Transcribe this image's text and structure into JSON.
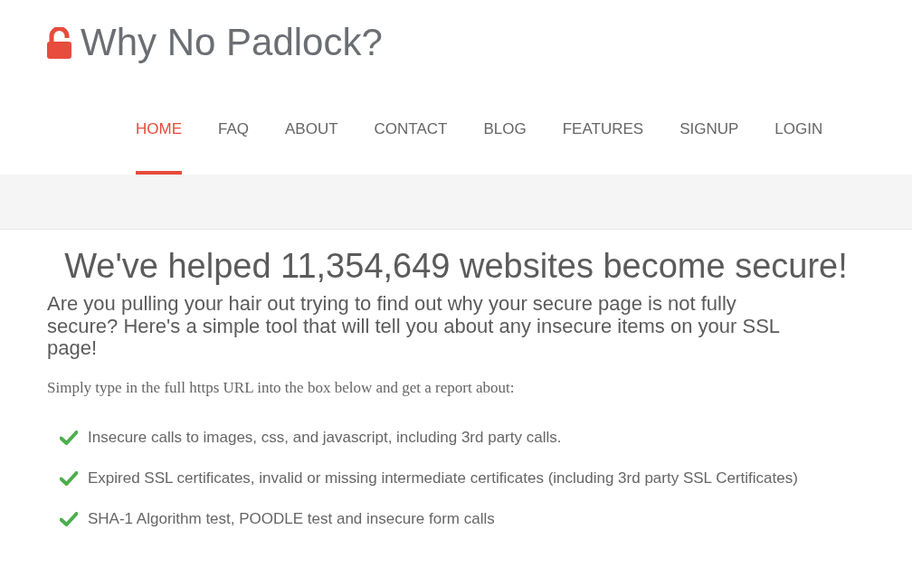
{
  "logo": {
    "title": "Why No Padlock?"
  },
  "nav": [
    {
      "label": "HOME",
      "selected": true
    },
    {
      "label": "FAQ",
      "selected": false
    },
    {
      "label": "ABOUT",
      "selected": false
    },
    {
      "label": "CONTACT",
      "selected": false
    },
    {
      "label": "BLOG",
      "selected": false
    },
    {
      "label": "FEATURES",
      "selected": false
    },
    {
      "label": "SIGNUP",
      "selected": false
    },
    {
      "label": "LOGIN",
      "selected": false
    }
  ],
  "headline": "We've helped 11,354,649 websites become secure!",
  "intro": "Are you pulling your hair out trying to find out why your secure page is not fully secure? Here's a simple tool that will tell you about any insecure items on your SSL page!",
  "instruction": "Simply type in the full https URL into the box below and get a report about:",
  "features": [
    "Insecure calls to images, css, and javascript, including 3rd party calls.",
    "Expired SSL certificates, invalid or missing intermediate certificates (including 3rd party SSL Certificates)",
    "SHA-1 Algorithm test, POODLE test and insecure form calls"
  ]
}
